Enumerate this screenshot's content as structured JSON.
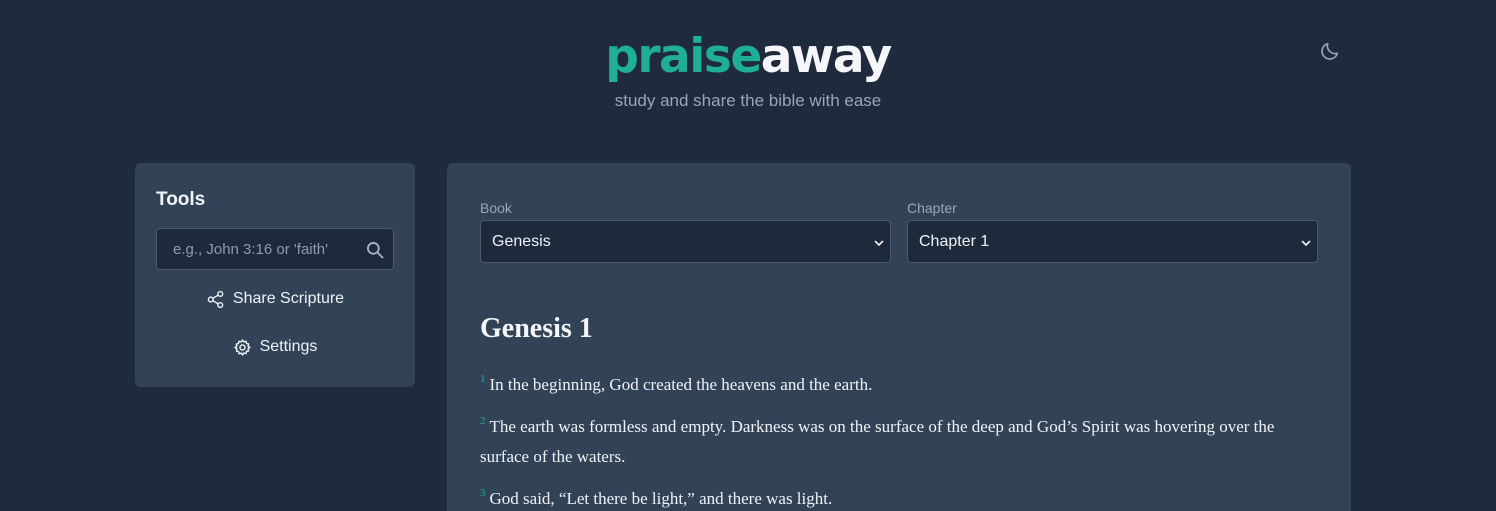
{
  "header": {
    "brand_part1": "praise",
    "brand_part2": "away",
    "tagline": "study and share the bible with ease",
    "theme_toggle_icon": "moon-icon"
  },
  "tools": {
    "title": "Tools",
    "search_placeholder": "e.g., John 3:16 or 'faith'",
    "search_value": "",
    "share_label": "Share Scripture",
    "settings_label": "Settings"
  },
  "reader": {
    "book_label": "Book",
    "book_value": "Genesis",
    "chapter_label": "Chapter",
    "chapter_value": "Chapter 1",
    "heading": "Genesis 1",
    "verses": [
      {
        "num": "1",
        "text": "In the beginning, God created the heavens and the earth."
      },
      {
        "num": "2",
        "text": "The earth was formless and empty. Darkness was on the surface of the deep and God’s Spirit was hovering over the surface of the waters."
      },
      {
        "num": "3",
        "text": "God said, “Let there be light,” and there was light."
      }
    ]
  },
  "colors": {
    "background": "#1f2a3d",
    "card": "#334357",
    "accent": "#1fae98",
    "input_bg": "#1e293b"
  }
}
